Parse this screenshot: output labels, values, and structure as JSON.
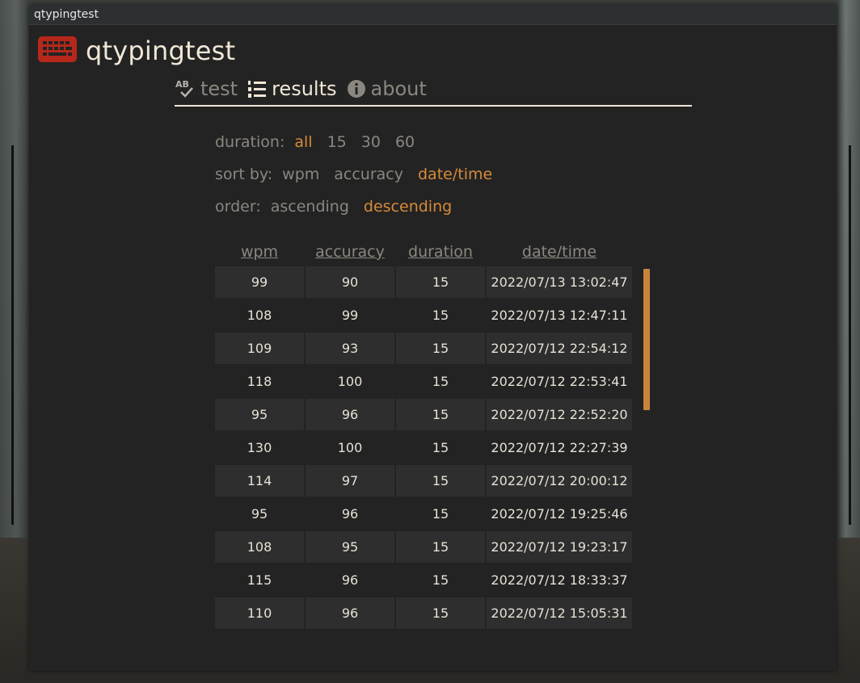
{
  "window": {
    "title": "qtypingtest"
  },
  "app": {
    "title": "qtypingtest",
    "icon": "keyboard-icon",
    "accent": "#d68b39",
    "icon_color": "#c53a2a"
  },
  "nav": {
    "items": [
      {
        "label": "test",
        "icon": "spellcheck-icon",
        "active": false
      },
      {
        "label": "results",
        "icon": "numbered-list-icon",
        "active": true
      },
      {
        "label": "about",
        "icon": "info-icon",
        "active": false
      }
    ]
  },
  "filters": {
    "duration": {
      "label": "duration:",
      "options": [
        "all",
        "15",
        "30",
        "60"
      ],
      "selected": "all"
    },
    "sort_by": {
      "label": "sort by:",
      "options": [
        "wpm",
        "accuracy",
        "date/time"
      ],
      "selected": "date/time"
    },
    "order": {
      "label": "order:",
      "options": [
        "ascending",
        "descending"
      ],
      "selected": "descending"
    }
  },
  "table": {
    "columns": [
      "wpm",
      "accuracy",
      "duration",
      "date/time"
    ],
    "rows": [
      [
        "99",
        "90",
        "15",
        "2022/07/13 13:02:47"
      ],
      [
        "108",
        "99",
        "15",
        "2022/07/13 12:47:11"
      ],
      [
        "109",
        "93",
        "15",
        "2022/07/12 22:54:12"
      ],
      [
        "118",
        "100",
        "15",
        "2022/07/12 22:53:41"
      ],
      [
        "95",
        "96",
        "15",
        "2022/07/12 22:52:20"
      ],
      [
        "130",
        "100",
        "15",
        "2022/07/12 22:27:39"
      ],
      [
        "114",
        "97",
        "15",
        "2022/07/12 20:00:12"
      ],
      [
        "95",
        "96",
        "15",
        "2022/07/12 19:25:46"
      ],
      [
        "108",
        "95",
        "15",
        "2022/07/12 19:23:17"
      ],
      [
        "115",
        "96",
        "15",
        "2022/07/12 18:33:37"
      ],
      [
        "110",
        "96",
        "15",
        "2022/07/12 15:05:31"
      ]
    ]
  }
}
